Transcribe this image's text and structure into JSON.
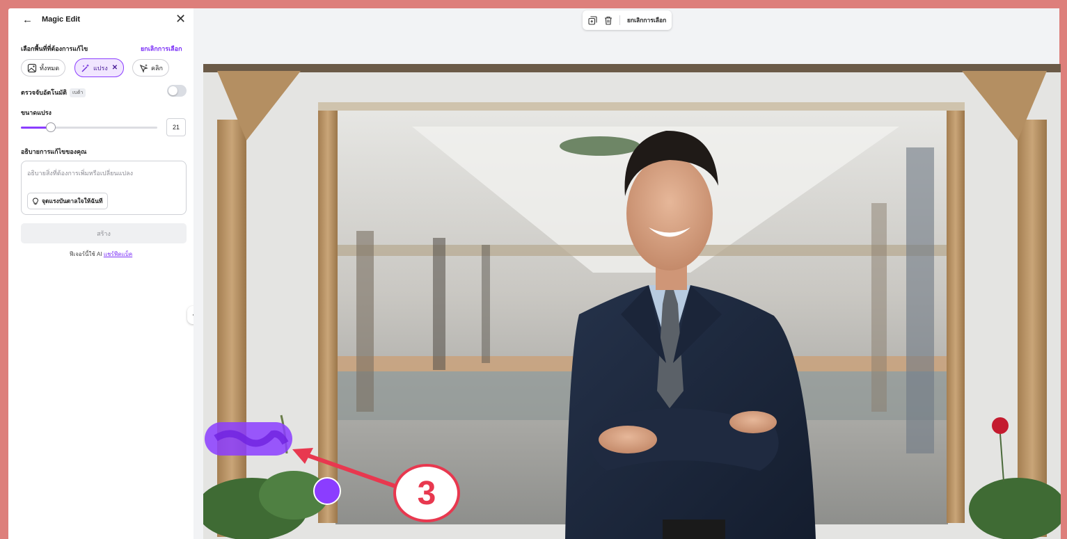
{
  "panel": {
    "title": "Magic Edit",
    "select_area_label": "เลือกพื้นที่ที่ต้องการแก้ไข",
    "deselect_link": "ยกเลิกการเลือก",
    "tools": [
      {
        "label": "ทั้งหมด",
        "icon": "image-icon"
      },
      {
        "label": "แปรง",
        "icon": "magic-brush-icon",
        "active": true
      },
      {
        "label": "คลิก",
        "icon": "click-sparkle-icon"
      }
    ],
    "auto_detect_label": "ตรวจจับอัตโนมัติ",
    "beta_badge": "เบต้า",
    "auto_detect_on": false,
    "brush_size_label": "ขนาดแปรง",
    "brush_size_value": "21",
    "brush_size_fraction": 0.22,
    "describe_label": "อธิบายการแก้ไขของคุณ",
    "describe_placeholder": "อธิบายสิ่งที่ต้องการเพิ่มหรือเปลี่ยนแปลง",
    "inspire_button": "จุดแรงบันดาลใจให้ฉันที",
    "create_button": "สร้าง",
    "footer_text": "ฟีเจอร์นี้ใช้ AI",
    "footer_link": "แชร์ฟีดแบ็ค"
  },
  "toolbar": {
    "deselect_label": "ยกเลิกการเลือก"
  },
  "annotation": {
    "step_number": "3"
  },
  "colors": {
    "accent": "#8b3dff",
    "background": "#dd7f7b",
    "arrow": "#e8384f"
  }
}
